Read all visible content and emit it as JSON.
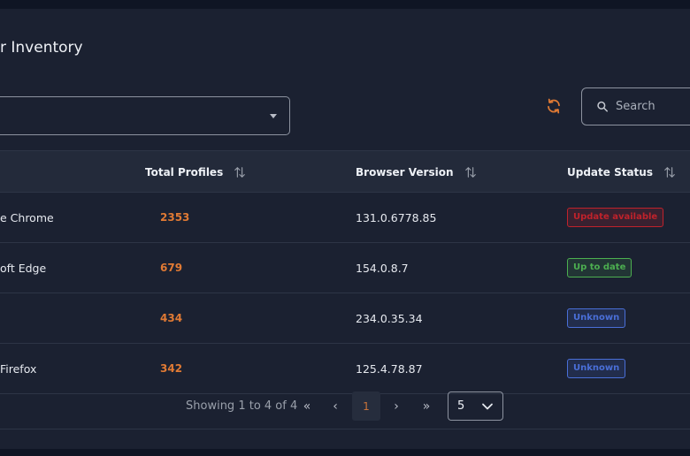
{
  "page": {
    "title": "r Inventory"
  },
  "filter": {
    "selected": ""
  },
  "search": {
    "placeholder": "Search"
  },
  "colors": {
    "accent": "#e07a34",
    "update_available": "#c0222b",
    "up_to_date": "#4caf50",
    "unknown": "#4a6fd8"
  },
  "table": {
    "columns": [
      {
        "label": ""
      },
      {
        "label": "Total Profiles"
      },
      {
        "label": "Browser Version"
      },
      {
        "label": "Update Status"
      }
    ],
    "rows": [
      {
        "browser": "e Chrome",
        "profiles": "2353",
        "version": "131.0.6778.85",
        "status": "Update available",
        "status_kind": "update_available"
      },
      {
        "browser": "oft Edge",
        "profiles": "679",
        "version": "154.0.8.7",
        "status": "Up to date",
        "status_kind": "up_to_date"
      },
      {
        "browser": "",
        "profiles": "434",
        "version": "234.0.35.34",
        "status": "Unknown",
        "status_kind": "unknown"
      },
      {
        "browser": "Firefox",
        "profiles": "342",
        "version": "125.4.78.87",
        "status": "Unknown",
        "status_kind": "unknown"
      }
    ]
  },
  "pagination": {
    "showing": "Showing 1 to 4 of 4",
    "first": "«",
    "prev": "‹",
    "current": "1",
    "next": "›",
    "last": "»",
    "page_size": "5"
  }
}
